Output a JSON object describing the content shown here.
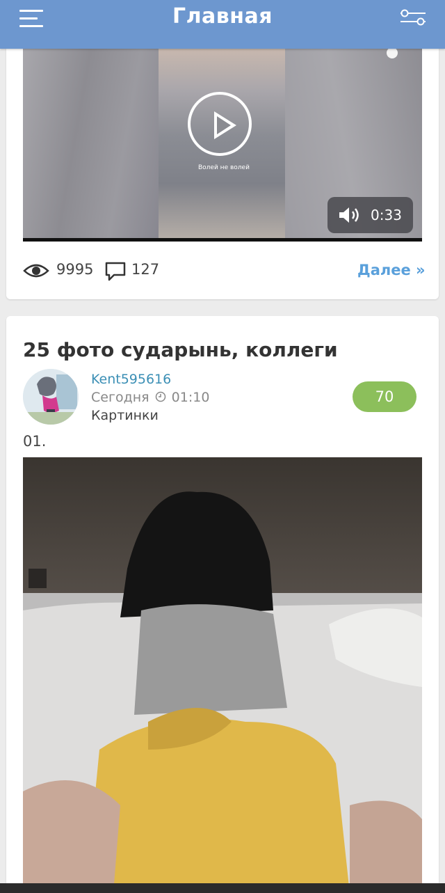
{
  "header": {
    "title": "Главная",
    "menu_icon": "hamburger-menu-icon",
    "filter_icon": "sliders-filter-icon",
    "background": "#6d97cf"
  },
  "video_post": {
    "caption": "Волей не волей",
    "duration": "0:33",
    "views": "9995",
    "comments": "127",
    "more_label": "Далее »"
  },
  "post": {
    "title": "25 фото сударынь, коллеги",
    "author": "Kent595616",
    "date": "Сегодня",
    "time": "01:10",
    "category": "Картинки",
    "rating": "70",
    "index_label": "01."
  },
  "colors": {
    "accent_link": "#5aa0db",
    "author": "#3b8fb5",
    "rating_badge": "#8cbf5b"
  }
}
